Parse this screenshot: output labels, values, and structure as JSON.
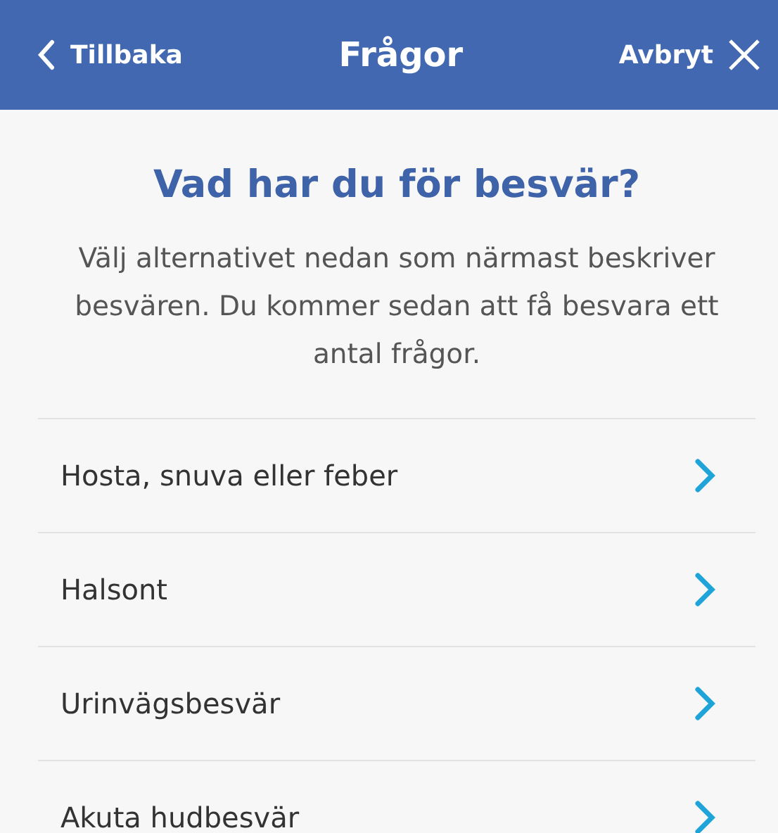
{
  "header": {
    "back_label": "Tillbaka",
    "title": "Frågor",
    "cancel_label": "Avbryt"
  },
  "heading": "Vad har du för besvär?",
  "intro": "Välj alternativet nedan som närmast beskriver besvären. Du kommer sedan att få besvara ett antal frågor.",
  "options": [
    {
      "label": "Hosta, snuva eller feber"
    },
    {
      "label": "Halsont"
    },
    {
      "label": "Urinvägsbesvär"
    },
    {
      "label": "Akuta hudbesvär"
    }
  ]
}
